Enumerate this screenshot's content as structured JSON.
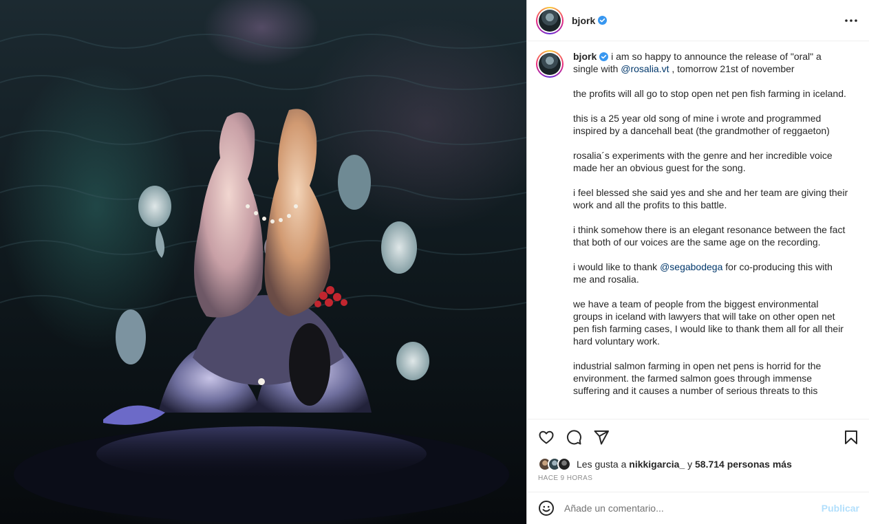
{
  "post": {
    "username": "bjork",
    "verified": true,
    "more_icon": "more-horizontal-icon"
  },
  "caption": {
    "username": "bjork",
    "first_line_pre": "i am so happy to announce the release of \"oral\" a single with ",
    "mention_1": "@rosalia.vt",
    "first_line_post": " , tomorrow 21st of november",
    "paragraphs": [
      "the profits will all go to stop open net pen fish farming in iceland.",
      "this is a 25 year old song of mine i wrote and programmed inspired by a dancehall beat (the grandmother of reggaeton)",
      "rosalia´s experiments with the genre and her incredible voice made her an obvious guest for the song.",
      "i feel blessed she said yes and she and her team are giving their work and all the profits to this battle.",
      "i think somehow there is an elegant resonance between the fact that both of our voices are the same age on the recording."
    ],
    "thanks_pre": "i would like to thank ",
    "mention_2": "@segabodega",
    "thanks_post": " for co-producing this with me and rosalia.",
    "paragraphs_2": [
      "we have a team of people from the biggest environmental groups in iceland with lawyers that will take on other open net pen fish farming cases, I would like to thank them all for all their hard voluntary work.",
      "industrial salmon farming in open net pens is horrid for the environment. the farmed salmon goes through immense suffering and it causes a number of serious threats to this"
    ]
  },
  "actions": {
    "like_icon": "heart-icon",
    "comment_icon": "comment-icon",
    "share_icon": "send-icon",
    "save_icon": "bookmark-icon"
  },
  "likes": {
    "prefix": "Les gusta a",
    "user": "nikkigarcia_",
    "joiner": "y",
    "others": "58.714 personas más"
  },
  "timestamp": "HACE 9 HORAS",
  "comment": {
    "placeholder": "Añade un comentario...",
    "publish_label": "Publicar",
    "emoji_icon": "emoji-icon"
  },
  "colors": {
    "verified_blue": "#3897f0",
    "mention_blue": "#00376b",
    "publish_disabled": "#b2dffc",
    "muted_text": "#8e8e8e"
  }
}
